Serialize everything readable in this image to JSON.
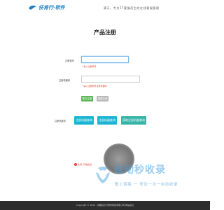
{
  "header": {
    "logo_text": "任肯行·软件",
    "slogan": "满天，专为IT客服而生的在线客服管理"
  },
  "form": {
    "title": "产品注册",
    "machine_code_label": "注册机码",
    "machine_code_value": "",
    "machine_code_hint": "* 输入注册机号",
    "reg_code_label": "注册机器码",
    "reg_code_value": "",
    "reg_code_hint": "* 输入注册机号注册机器码",
    "submit_label": "提交注册",
    "reset_label": "重置注册"
  },
  "actions": {
    "label": "注册机服务",
    "btn1": "注册机器查询",
    "btn2": "注册机器查询",
    "btn3": "获取注册机器查询"
  },
  "notice": "注意: 开始验证",
  "watermark": {
    "main": "自动秒收录",
    "sub": "散上链接 一 来访一次一自动收录"
  },
  "footer": {
    "text": "Copyright © 2020 - 成都任肯行软件科技有限公司·网站后台"
  },
  "colors": {
    "brand": "#1b7fc4",
    "submit": "#5cb85c",
    "action": "#1cb4d2",
    "hint": "#e53b2c",
    "footer_bg": "#2d2d2d"
  }
}
